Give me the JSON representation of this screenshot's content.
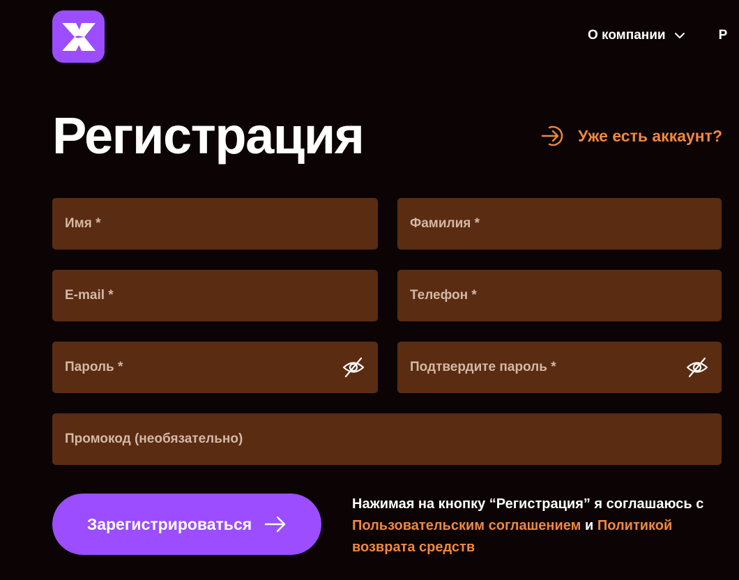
{
  "header": {
    "logo": {
      "icon": "x-logo-icon",
      "color": "#9b4dff"
    },
    "nav": [
      {
        "label": "О компании",
        "icon": "chevron-down-icon"
      },
      {
        "label": "Р"
      }
    ]
  },
  "page": {
    "title": "Регистрация",
    "login_link": {
      "label": "Уже есть аккаунт?",
      "icon": "arrow-right-circle-icon",
      "color": "#f0883e"
    }
  },
  "form": {
    "first_name": {
      "placeholder": "Имя *",
      "value": ""
    },
    "last_name": {
      "placeholder": "Фамилия *",
      "value": ""
    },
    "email": {
      "placeholder": "E-mail *",
      "value": ""
    },
    "phone": {
      "placeholder": "Телефон *",
      "value": ""
    },
    "password": {
      "placeholder": "Пароль *",
      "value": "",
      "icon": "eye-off-icon"
    },
    "password_confirm": {
      "placeholder": "Подтвердите пароль *",
      "value": "",
      "icon": "eye-off-icon"
    },
    "promo": {
      "placeholder": "Промокод (необязательно)",
      "value": ""
    },
    "field_color": "#5a2c12"
  },
  "submit": {
    "label": "Зарегистрироваться",
    "icon": "arrow-right-icon",
    "color": "#9b4dff"
  },
  "agreement": {
    "prefix": "Нажимая на кнопку “Регистрация” я соглашаюсь с ",
    "terms_link": "Пользовательским соглашением",
    "and": " и ",
    "refund_link": "Политикой возврата средств"
  },
  "colors": {
    "background": "#0b0304",
    "accent_purple": "#9b4dff",
    "accent_orange": "#f0883e"
  }
}
